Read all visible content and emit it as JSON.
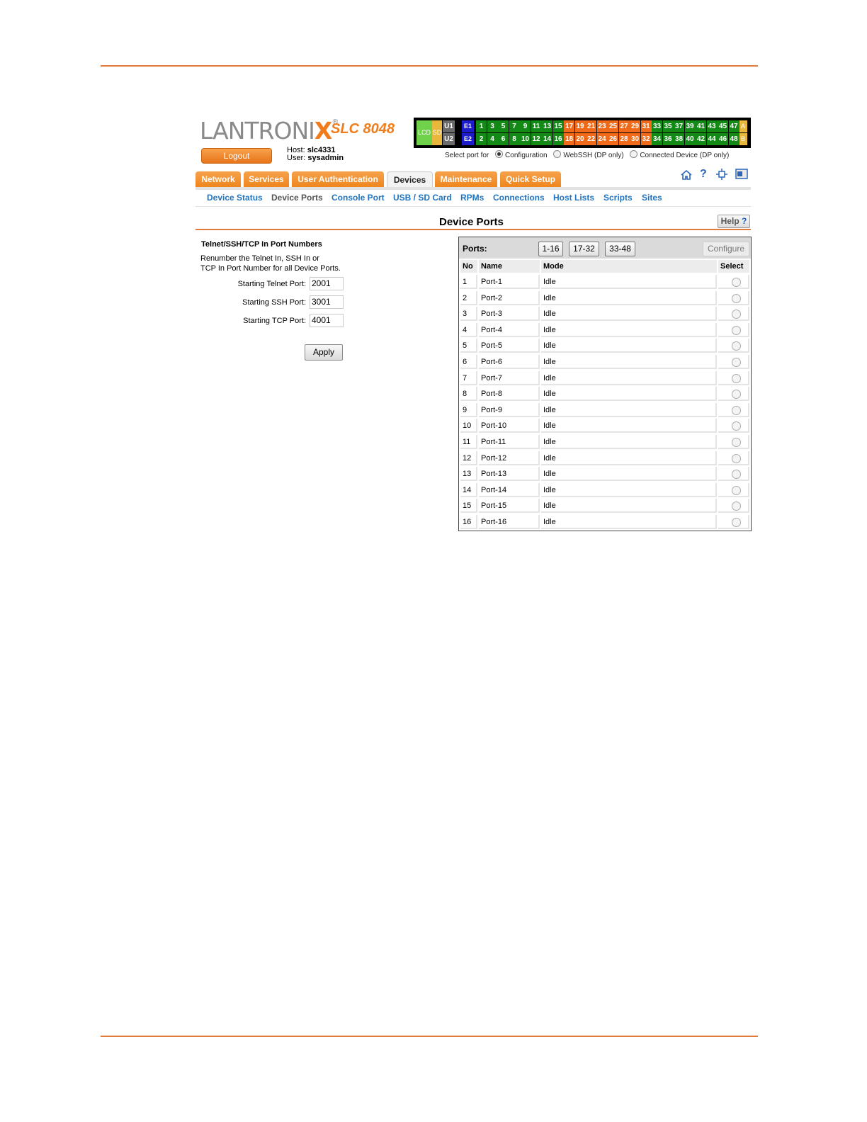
{
  "brand": {
    "name_part1": "LANTRONI",
    "name_part2": "X",
    "reg": "®",
    "model": "SLC 8048"
  },
  "header": {
    "logout_label": "Logout",
    "host_label": "Host:",
    "host": "slc4331",
    "user_label": "User:",
    "user": "sysadmin"
  },
  "status_panel": {
    "lcd": "LCD",
    "sd": "SD",
    "u1": "U1",
    "u2": "U2",
    "e1": "E1",
    "e2": "E2",
    "a": "A",
    "b": "B",
    "top_ports": [
      "1",
      "3",
      "5",
      "7",
      "9",
      "11",
      "13",
      "15",
      "17",
      "19",
      "21",
      "23",
      "25",
      "27",
      "29",
      "31",
      "33",
      "35",
      "37",
      "39",
      "41",
      "43",
      "45",
      "47"
    ],
    "bottom_ports": [
      "2",
      "4",
      "6",
      "8",
      "10",
      "12",
      "14",
      "16",
      "18",
      "20",
      "22",
      "24",
      "26",
      "28",
      "30",
      "32",
      "34",
      "36",
      "38",
      "40",
      "42",
      "44",
      "46",
      "48"
    ],
    "port_colors": {
      "green": "#138a16",
      "orange": "#f06a1a"
    },
    "orange_range": "17-32"
  },
  "select_port_for": {
    "label": "Select port for",
    "options": [
      {
        "label": "Configuration",
        "selected": true
      },
      {
        "label": "WebSSH (DP only)",
        "selected": false
      },
      {
        "label": "Connected Device (DP only)",
        "selected": false
      }
    ]
  },
  "tabs": [
    {
      "label": "Network",
      "active": false
    },
    {
      "label": "Services",
      "active": false
    },
    {
      "label": "User Authentication",
      "active": false
    },
    {
      "label": "Devices",
      "active": true
    },
    {
      "label": "Maintenance",
      "active": false
    },
    {
      "label": "Quick Setup",
      "active": false
    }
  ],
  "tool_icons": [
    "home-icon",
    "help-icon",
    "sitemap-icon",
    "panel-icon"
  ],
  "subnav": [
    {
      "label": "Device Status",
      "current": false
    },
    {
      "label": "Device Ports",
      "current": true
    },
    {
      "label": "Console Port",
      "current": false
    },
    {
      "label": "USB / SD Card",
      "current": false
    },
    {
      "label": "RPMs",
      "current": false
    },
    {
      "label": "Connections",
      "current": false
    },
    {
      "label": "Host Lists",
      "current": false
    },
    {
      "label": "Scripts",
      "current": false
    },
    {
      "label": "Sites",
      "current": false
    }
  ],
  "page": {
    "title": "Device Ports",
    "help_label": "Help",
    "help_q": "?"
  },
  "form": {
    "title": "Telnet/SSH/TCP In Port Numbers",
    "desc_line1": "Renumber the Telnet In, SSH In or",
    "desc_line2": "TCP In Port Number for all Device Ports.",
    "telnet_label": "Starting Telnet Port:",
    "telnet_value": "2001",
    "ssh_label": "Starting SSH Port:",
    "ssh_value": "3001",
    "tcp_label": "Starting TCP Port:",
    "tcp_value": "4001",
    "apply_label": "Apply"
  },
  "ports_table": {
    "ports_label": "Ports:",
    "range_buttons": [
      "1-16",
      "17-32",
      "33-48"
    ],
    "configure_label": "Configure",
    "columns": [
      "No",
      "Name",
      "Mode",
      "Select"
    ],
    "rows": [
      {
        "no": "1",
        "name": "Port-1",
        "mode": "Idle"
      },
      {
        "no": "2",
        "name": "Port-2",
        "mode": "Idle"
      },
      {
        "no": "3",
        "name": "Port-3",
        "mode": "Idle"
      },
      {
        "no": "4",
        "name": "Port-4",
        "mode": "Idle"
      },
      {
        "no": "5",
        "name": "Port-5",
        "mode": "Idle"
      },
      {
        "no": "6",
        "name": "Port-6",
        "mode": "Idle"
      },
      {
        "no": "7",
        "name": "Port-7",
        "mode": "Idle"
      },
      {
        "no": "8",
        "name": "Port-8",
        "mode": "Idle"
      },
      {
        "no": "9",
        "name": "Port-9",
        "mode": "Idle"
      },
      {
        "no": "10",
        "name": "Port-10",
        "mode": "Idle"
      },
      {
        "no": "11",
        "name": "Port-11",
        "mode": "Idle"
      },
      {
        "no": "12",
        "name": "Port-12",
        "mode": "Idle"
      },
      {
        "no": "13",
        "name": "Port-13",
        "mode": "Idle"
      },
      {
        "no": "14",
        "name": "Port-14",
        "mode": "Idle"
      },
      {
        "no": "15",
        "name": "Port-15",
        "mode": "Idle"
      },
      {
        "no": "16",
        "name": "Port-16",
        "mode": "Idle"
      }
    ]
  }
}
